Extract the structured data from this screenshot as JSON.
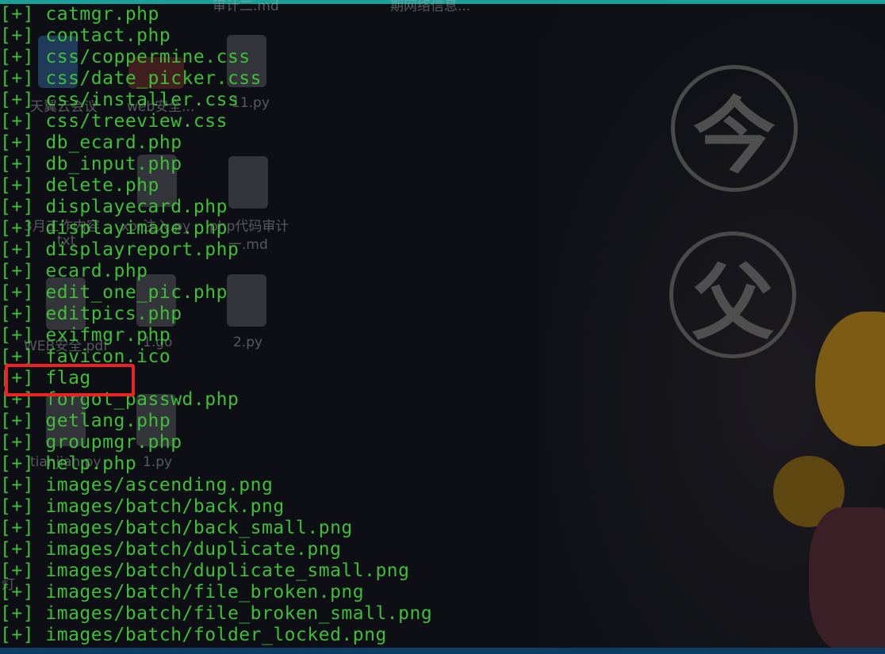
{
  "terminal": {
    "prefix": "[+]",
    "lines": [
      "[+] catmgr.php",
      "[+] contact.php",
      "[+] css/coppermine.css",
      "[+] css/date_picker.css",
      "[+] css/installer.css",
      "[+] css/treeview.css",
      "[+] db_ecard.php",
      "[+] db_input.php",
      "[+] delete.php",
      "[+] displayecard.php",
      "[+] displayimage.php",
      "[+] displayreport.php",
      "[+] ecard.php",
      "[+] edit_one_pic.php",
      "[+] editpics.php",
      "[+] exifmgr.php",
      "[+] favicon.ico",
      "[+] flag",
      "[+] forgot_passwd.php",
      "[+] getlang.php",
      "[+] groupmgr.php",
      "[+] help.php",
      "[+] images/ascending.png",
      "[+] images/batch/back.png",
      "[+] images/batch/back_small.png",
      "[+] images/batch/duplicate.png",
      "[+] images/batch/duplicate_small.png",
      "[+] images/batch/file_broken.png",
      "[+] images/batch/file_broken_small.png",
      "[+] images/batch/folder_locked.png"
    ],
    "highlighted_entry": "flag",
    "text_color": "#3fbe38",
    "highlight_color": "#ee2222"
  },
  "desktop_ghost": {
    "labels": [
      "审计二.md",
      "期网络信息...",
      "天翼云会议",
      "web安全...",
      "11.py",
      "3月工作内容",
      "xor注入.py",
      "php代码审计",
      "一.md",
      "txt",
      "WEB安全.pdf",
      "1.go",
      "2.py",
      "tianjian.py",
      "1.py",
      "灯"
    ]
  },
  "wallpaper": {
    "glyph_top": "今",
    "glyph_bottom": "父"
  }
}
